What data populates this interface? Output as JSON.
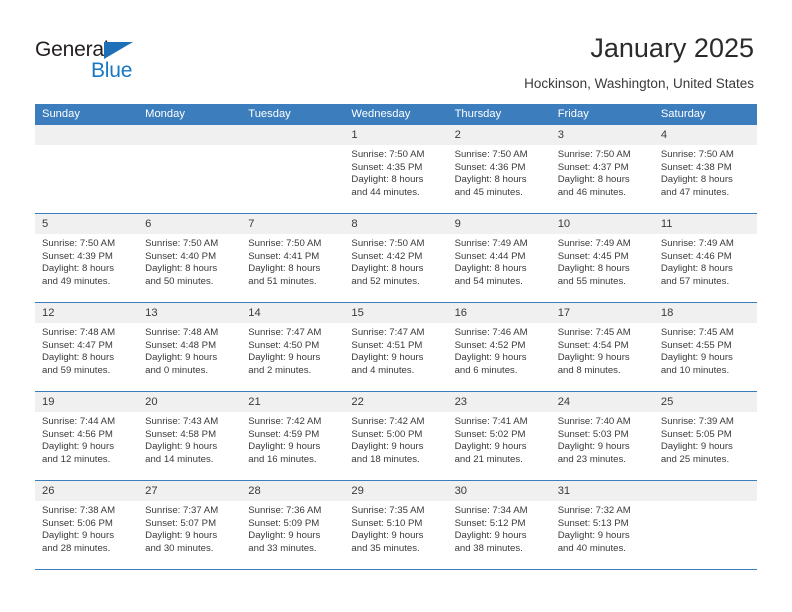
{
  "brand": {
    "name_part1": "General",
    "name_part2": "Blue",
    "accent_color": "#1878c4",
    "triangle_color": "#1d6fb8"
  },
  "header": {
    "title": "January 2025",
    "subtitle": "Hockinson, Washington, United States"
  },
  "theme": {
    "header_row_bg": "#3b7dbd",
    "day_band_bg": "#f0f0f0",
    "text_color": "#3a3a3a"
  },
  "weekdays": [
    "Sunday",
    "Monday",
    "Tuesday",
    "Wednesday",
    "Thursday",
    "Friday",
    "Saturday"
  ],
  "weeks": [
    [
      {
        "day": "",
        "sunrise": "",
        "sunset": "",
        "daylight1": "",
        "daylight2": ""
      },
      {
        "day": "",
        "sunrise": "",
        "sunset": "",
        "daylight1": "",
        "daylight2": ""
      },
      {
        "day": "",
        "sunrise": "",
        "sunset": "",
        "daylight1": "",
        "daylight2": ""
      },
      {
        "day": "1",
        "sunrise": "Sunrise: 7:50 AM",
        "sunset": "Sunset: 4:35 PM",
        "daylight1": "Daylight: 8 hours",
        "daylight2": "and 44 minutes."
      },
      {
        "day": "2",
        "sunrise": "Sunrise: 7:50 AM",
        "sunset": "Sunset: 4:36 PM",
        "daylight1": "Daylight: 8 hours",
        "daylight2": "and 45 minutes."
      },
      {
        "day": "3",
        "sunrise": "Sunrise: 7:50 AM",
        "sunset": "Sunset: 4:37 PM",
        "daylight1": "Daylight: 8 hours",
        "daylight2": "and 46 minutes."
      },
      {
        "day": "4",
        "sunrise": "Sunrise: 7:50 AM",
        "sunset": "Sunset: 4:38 PM",
        "daylight1": "Daylight: 8 hours",
        "daylight2": "and 47 minutes."
      }
    ],
    [
      {
        "day": "5",
        "sunrise": "Sunrise: 7:50 AM",
        "sunset": "Sunset: 4:39 PM",
        "daylight1": "Daylight: 8 hours",
        "daylight2": "and 49 minutes."
      },
      {
        "day": "6",
        "sunrise": "Sunrise: 7:50 AM",
        "sunset": "Sunset: 4:40 PM",
        "daylight1": "Daylight: 8 hours",
        "daylight2": "and 50 minutes."
      },
      {
        "day": "7",
        "sunrise": "Sunrise: 7:50 AM",
        "sunset": "Sunset: 4:41 PM",
        "daylight1": "Daylight: 8 hours",
        "daylight2": "and 51 minutes."
      },
      {
        "day": "8",
        "sunrise": "Sunrise: 7:50 AM",
        "sunset": "Sunset: 4:42 PM",
        "daylight1": "Daylight: 8 hours",
        "daylight2": "and 52 minutes."
      },
      {
        "day": "9",
        "sunrise": "Sunrise: 7:49 AM",
        "sunset": "Sunset: 4:44 PM",
        "daylight1": "Daylight: 8 hours",
        "daylight2": "and 54 minutes."
      },
      {
        "day": "10",
        "sunrise": "Sunrise: 7:49 AM",
        "sunset": "Sunset: 4:45 PM",
        "daylight1": "Daylight: 8 hours",
        "daylight2": "and 55 minutes."
      },
      {
        "day": "11",
        "sunrise": "Sunrise: 7:49 AM",
        "sunset": "Sunset: 4:46 PM",
        "daylight1": "Daylight: 8 hours",
        "daylight2": "and 57 minutes."
      }
    ],
    [
      {
        "day": "12",
        "sunrise": "Sunrise: 7:48 AM",
        "sunset": "Sunset: 4:47 PM",
        "daylight1": "Daylight: 8 hours",
        "daylight2": "and 59 minutes."
      },
      {
        "day": "13",
        "sunrise": "Sunrise: 7:48 AM",
        "sunset": "Sunset: 4:48 PM",
        "daylight1": "Daylight: 9 hours",
        "daylight2": "and 0 minutes."
      },
      {
        "day": "14",
        "sunrise": "Sunrise: 7:47 AM",
        "sunset": "Sunset: 4:50 PM",
        "daylight1": "Daylight: 9 hours",
        "daylight2": "and 2 minutes."
      },
      {
        "day": "15",
        "sunrise": "Sunrise: 7:47 AM",
        "sunset": "Sunset: 4:51 PM",
        "daylight1": "Daylight: 9 hours",
        "daylight2": "and 4 minutes."
      },
      {
        "day": "16",
        "sunrise": "Sunrise: 7:46 AM",
        "sunset": "Sunset: 4:52 PM",
        "daylight1": "Daylight: 9 hours",
        "daylight2": "and 6 minutes."
      },
      {
        "day": "17",
        "sunrise": "Sunrise: 7:45 AM",
        "sunset": "Sunset: 4:54 PM",
        "daylight1": "Daylight: 9 hours",
        "daylight2": "and 8 minutes."
      },
      {
        "day": "18",
        "sunrise": "Sunrise: 7:45 AM",
        "sunset": "Sunset: 4:55 PM",
        "daylight1": "Daylight: 9 hours",
        "daylight2": "and 10 minutes."
      }
    ],
    [
      {
        "day": "19",
        "sunrise": "Sunrise: 7:44 AM",
        "sunset": "Sunset: 4:56 PM",
        "daylight1": "Daylight: 9 hours",
        "daylight2": "and 12 minutes."
      },
      {
        "day": "20",
        "sunrise": "Sunrise: 7:43 AM",
        "sunset": "Sunset: 4:58 PM",
        "daylight1": "Daylight: 9 hours",
        "daylight2": "and 14 minutes."
      },
      {
        "day": "21",
        "sunrise": "Sunrise: 7:42 AM",
        "sunset": "Sunset: 4:59 PM",
        "daylight1": "Daylight: 9 hours",
        "daylight2": "and 16 minutes."
      },
      {
        "day": "22",
        "sunrise": "Sunrise: 7:42 AM",
        "sunset": "Sunset: 5:00 PM",
        "daylight1": "Daylight: 9 hours",
        "daylight2": "and 18 minutes."
      },
      {
        "day": "23",
        "sunrise": "Sunrise: 7:41 AM",
        "sunset": "Sunset: 5:02 PM",
        "daylight1": "Daylight: 9 hours",
        "daylight2": "and 21 minutes."
      },
      {
        "day": "24",
        "sunrise": "Sunrise: 7:40 AM",
        "sunset": "Sunset: 5:03 PM",
        "daylight1": "Daylight: 9 hours",
        "daylight2": "and 23 minutes."
      },
      {
        "day": "25",
        "sunrise": "Sunrise: 7:39 AM",
        "sunset": "Sunset: 5:05 PM",
        "daylight1": "Daylight: 9 hours",
        "daylight2": "and 25 minutes."
      }
    ],
    [
      {
        "day": "26",
        "sunrise": "Sunrise: 7:38 AM",
        "sunset": "Sunset: 5:06 PM",
        "daylight1": "Daylight: 9 hours",
        "daylight2": "and 28 minutes."
      },
      {
        "day": "27",
        "sunrise": "Sunrise: 7:37 AM",
        "sunset": "Sunset: 5:07 PM",
        "daylight1": "Daylight: 9 hours",
        "daylight2": "and 30 minutes."
      },
      {
        "day": "28",
        "sunrise": "Sunrise: 7:36 AM",
        "sunset": "Sunset: 5:09 PM",
        "daylight1": "Daylight: 9 hours",
        "daylight2": "and 33 minutes."
      },
      {
        "day": "29",
        "sunrise": "Sunrise: 7:35 AM",
        "sunset": "Sunset: 5:10 PM",
        "daylight1": "Daylight: 9 hours",
        "daylight2": "and 35 minutes."
      },
      {
        "day": "30",
        "sunrise": "Sunrise: 7:34 AM",
        "sunset": "Sunset: 5:12 PM",
        "daylight1": "Daylight: 9 hours",
        "daylight2": "and 38 minutes."
      },
      {
        "day": "31",
        "sunrise": "Sunrise: 7:32 AM",
        "sunset": "Sunset: 5:13 PM",
        "daylight1": "Daylight: 9 hours",
        "daylight2": "and 40 minutes."
      },
      {
        "day": "",
        "sunrise": "",
        "sunset": "",
        "daylight1": "",
        "daylight2": ""
      }
    ]
  ]
}
